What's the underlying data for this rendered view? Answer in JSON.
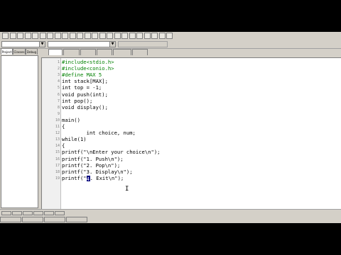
{
  "toolbar": {
    "buttons": [
      "",
      "",
      "",
      "",
      "",
      "",
      "",
      "",
      "",
      "",
      "",
      "",
      "",
      "",
      "",
      "",
      "",
      "",
      "",
      "",
      "",
      "",
      ""
    ]
  },
  "left_tabs": [
    "Project",
    "Classes",
    "Debug"
  ],
  "editor_tabs": [
    "",
    "",
    "",
    "",
    "",
    ""
  ],
  "code_lines": [
    {
      "n": "1",
      "text": "#include<stdio.h>",
      "pp": true
    },
    {
      "n": "2",
      "text": "#include<conio.h>",
      "pp": true
    },
    {
      "n": "3",
      "text": "#define MAX 5",
      "pp": true
    },
    {
      "n": "4",
      "text": "int stack[MAX];",
      "pp": false
    },
    {
      "n": "5",
      "text": "int top = -1;",
      "pp": false
    },
    {
      "n": "6",
      "text": "void push(int);",
      "pp": false
    },
    {
      "n": "7",
      "text": "int pop();",
      "pp": false
    },
    {
      "n": "8",
      "text": "void display();",
      "pp": false
    },
    {
      "n": "9",
      "text": "",
      "pp": false
    },
    {
      "n": "10",
      "text": "main()",
      "pp": false
    },
    {
      "n": "11",
      "text": "{",
      "pp": false
    },
    {
      "n": "12",
      "text": "        int choice, num;",
      "pp": false
    },
    {
      "n": "13",
      "text": "while(1)",
      "pp": false
    },
    {
      "n": "14",
      "text": "{",
      "pp": false
    },
    {
      "n": "15",
      "text": "printf(\"\\nEnter your choice\\n\");",
      "pp": false
    },
    {
      "n": "16",
      "text": "printf(\"1. Push\\n\");",
      "pp": false
    },
    {
      "n": "17",
      "text": "printf(\"2. Pop\\n\");",
      "pp": false
    },
    {
      "n": "18",
      "text": "printf(\"3. Display\\n\");",
      "pp": false
    }
  ],
  "last_line": {
    "n": "19",
    "before": "printf(\"",
    "selected": "4",
    "after": ". Exit\\n\");"
  },
  "bottom_tabs": [
    "",
    "",
    "",
    "",
    "",
    ""
  ],
  "status": [
    "",
    "",
    "",
    ""
  ]
}
